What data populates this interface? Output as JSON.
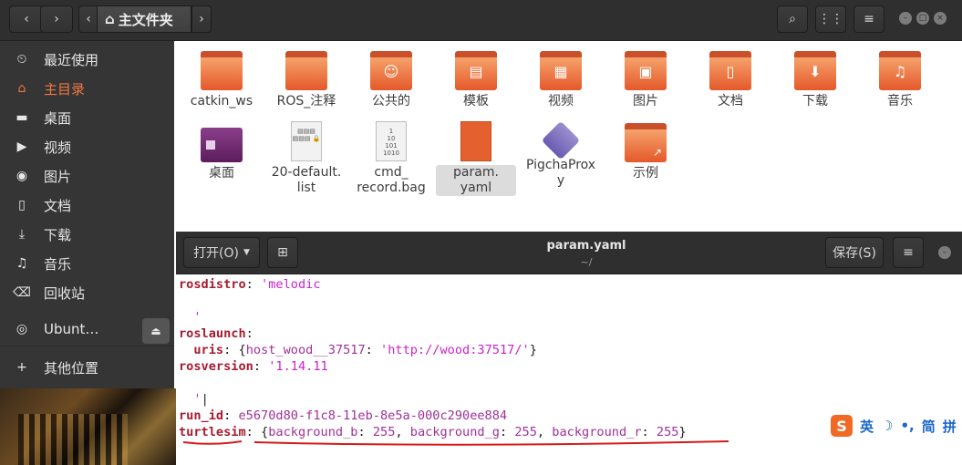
{
  "file_manager": {
    "breadcrumb": "主文件夹",
    "sidebar": [
      {
        "icon": "clock-icon",
        "glyph": "⏲",
        "label": "最近使用"
      },
      {
        "icon": "home-icon",
        "glyph": "⌂",
        "label": "主目录"
      },
      {
        "icon": "folder-icon",
        "glyph": "▬",
        "label": "桌面"
      },
      {
        "icon": "video-icon",
        "glyph": "▶",
        "label": "视频"
      },
      {
        "icon": "camera-icon",
        "glyph": "◉",
        "label": "图片"
      },
      {
        "icon": "document-icon",
        "glyph": "▯",
        "label": "文档"
      },
      {
        "icon": "download-icon",
        "glyph": "⤓",
        "label": "下载"
      },
      {
        "icon": "music-icon",
        "glyph": "♫",
        "label": "音乐"
      },
      {
        "icon": "trash-icon",
        "glyph": "⌫",
        "label": "回收站"
      },
      {
        "icon": "disc-icon",
        "glyph": "◎",
        "label": "Ubunt…"
      },
      {
        "icon": "plus-icon",
        "glyph": "+",
        "label": "其他位置"
      }
    ],
    "files": [
      {
        "label": "catkin_ws"
      },
      {
        "label": "ROS_注释"
      },
      {
        "label": "公共的"
      },
      {
        "label": "模板"
      },
      {
        "label": "视频"
      },
      {
        "label": "图片"
      },
      {
        "label": "文档"
      },
      {
        "label": "下载"
      },
      {
        "label": "音乐"
      },
      {
        "label": "桌面"
      },
      {
        "label": "20-default.\nlist"
      },
      {
        "label": "cmd_\nrecord.bag"
      },
      {
        "label": "param.\nyaml"
      },
      {
        "label": "PigchaProx\ny"
      },
      {
        "label": "示例"
      }
    ]
  },
  "editor": {
    "open_label": "打开(O)",
    "title": "param.yaml",
    "subtitle": "~/",
    "save_label": "保存(S)",
    "lines": {
      "l1_key": "rosdistro",
      "l1_val": "'melodic",
      "l2": "'",
      "l3_key": "roslaunch",
      "l4_key": "uris",
      "l4_open": "{",
      "l4_inner_key": "host_wood__37517",
      "l4_val": "'http://wood:37517/'",
      "l4_close": "}",
      "l5_key": "rosversion",
      "l5_val": "'1.14.11",
      "l6": "'",
      "l7_key": "run_id",
      "l7_val": "e5670d80-f1c8-11eb-8e5a-000c290ee884",
      "l8_key": "turtlesim",
      "l8_open": "{",
      "l8_k1": "background_b",
      "l8_v1": "255",
      "l8_k2": "background_g",
      "l8_v2": "255",
      "l8_k3": "background_r",
      "l8_v3": "255",
      "l8_close": "}"
    }
  },
  "ime": {
    "logo": "S",
    "mode": "英",
    "moon": "☽",
    "punct": "•,",
    "simp": "简",
    "pinyin": "拼"
  }
}
